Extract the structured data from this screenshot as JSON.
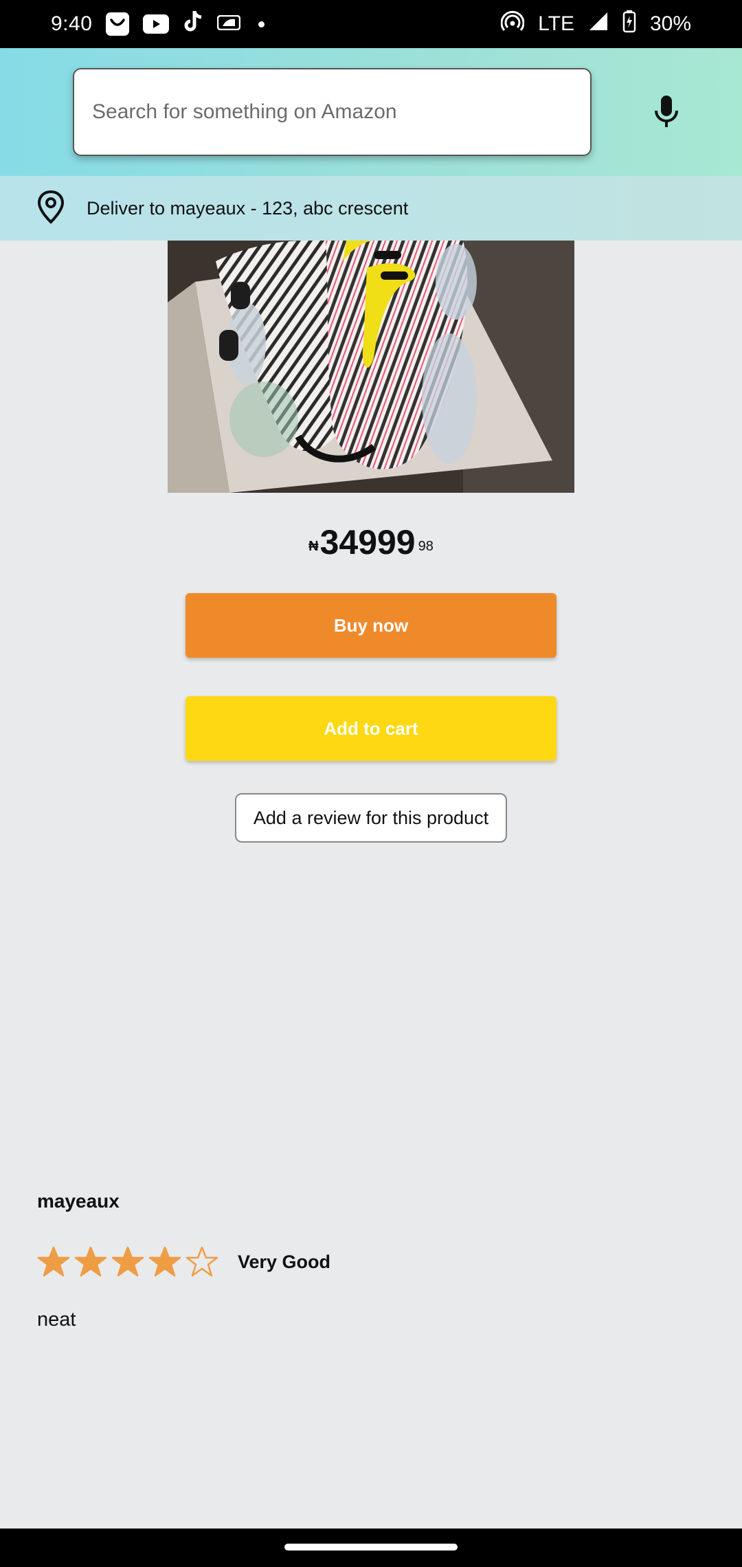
{
  "status_bar": {
    "time": "9:40",
    "network": "LTE",
    "battery": "30%",
    "icons": [
      "shopping-bag-icon",
      "youtube-icon",
      "tiktok-icon",
      "mlb-icon",
      "dot-icon",
      "hotspot-icon",
      "signal-icon",
      "battery-icon"
    ]
  },
  "search": {
    "placeholder": "Search for something on Amazon"
  },
  "delivery": {
    "text": "Deliver to mayeaux - 123, abc crescent"
  },
  "product": {
    "image": "sneaker-photo",
    "price": {
      "symbol": "₦",
      "main": "34999",
      "fraction": "98"
    }
  },
  "actions": {
    "buy_now": "Buy now",
    "add_to_cart": "Add to cart",
    "add_review": "Add a review for this product"
  },
  "review": {
    "author": "mayeaux",
    "rating": 4,
    "max_rating": 5,
    "rating_label": "Very Good",
    "text": "neat"
  },
  "colors": {
    "buy_now": "#ef8a2b",
    "add_to_cart": "#fed812",
    "star": "#ef9d45",
    "background": "#e9eaec"
  }
}
